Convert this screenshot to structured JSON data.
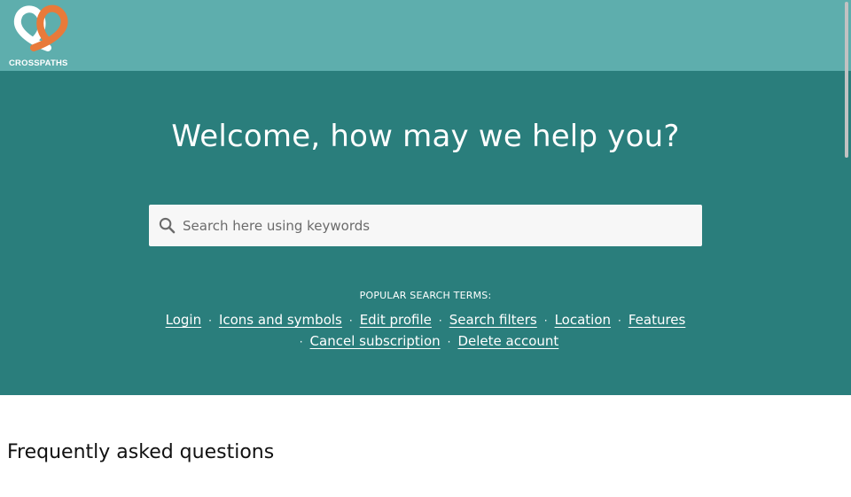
{
  "brand": {
    "name": "CROSSPATHS",
    "colors": {
      "topbar": "#5eaead",
      "hero": "#2a7e7c",
      "logo_orange": "#e87a3a",
      "logo_white": "#ffffff"
    }
  },
  "hero": {
    "title": "Welcome, how may we help you?"
  },
  "search": {
    "placeholder": "Search here using keywords",
    "icon": "search-icon"
  },
  "popular": {
    "label": "POPULAR SEARCH TERMS:",
    "row1": [
      "Login",
      "Icons and symbols",
      "Edit profile",
      "Search filters",
      "Location",
      "Features"
    ],
    "row2": [
      "Cancel subscription",
      "Delete account"
    ],
    "separator": "·"
  },
  "faq": {
    "title": "Frequently asked questions"
  }
}
